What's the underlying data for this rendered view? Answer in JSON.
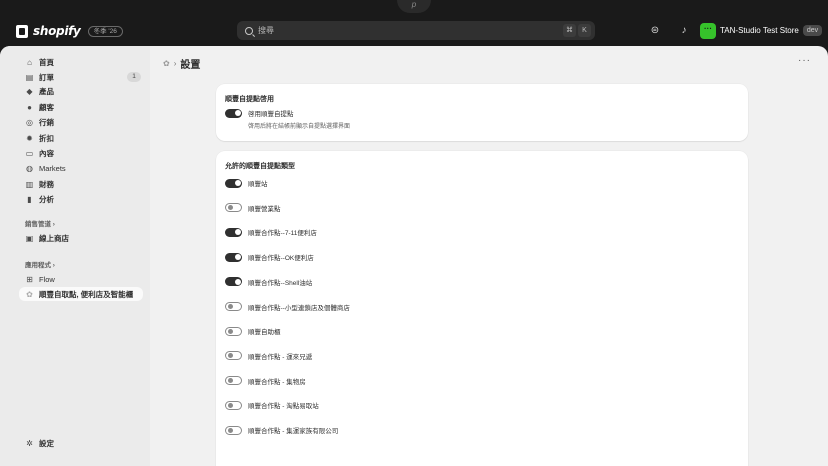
{
  "topbar": {
    "logo_text": "shopify",
    "version_badge": "冬季 '26",
    "search_placeholder": "搜尋",
    "shortcut_key1": "⌘",
    "shortcut_key2": "K",
    "notch_glyph": "p",
    "store_avatar_glyph": "···",
    "store_name": "TAN-Studio Test Store",
    "store_badge": "dev"
  },
  "sidebar": {
    "items": [
      {
        "label": "首頁",
        "icon": "home-icon",
        "glyph": "⌂"
      },
      {
        "label": "訂單",
        "icon": "orders-icon",
        "glyph": "▤",
        "count": "1"
      },
      {
        "label": "產品",
        "icon": "tag-icon",
        "glyph": "◆"
      },
      {
        "label": "顧客",
        "icon": "person-icon",
        "glyph": "●"
      },
      {
        "label": "行銷",
        "icon": "target-icon",
        "glyph": "◎"
      },
      {
        "label": "折扣",
        "icon": "discount-icon",
        "glyph": "✹"
      },
      {
        "label": "內容",
        "icon": "content-icon",
        "glyph": "▭"
      },
      {
        "label": "Markets",
        "icon": "globe-icon",
        "glyph": "◍"
      },
      {
        "label": "財務",
        "icon": "bank-icon",
        "glyph": "▥"
      },
      {
        "label": "分析",
        "icon": "chart-icon",
        "glyph": "▮"
      }
    ],
    "sales_channels_label": "銷售管道 ›",
    "online_store": {
      "label": "線上商店",
      "icon": "store-icon",
      "glyph": "▣"
    },
    "apps_label": "應用程式 ›",
    "flow": {
      "label": "Flow",
      "icon": "flow-icon",
      "glyph": "⊞"
    },
    "active_app": {
      "label": "順豐自取點, 便利店及智能櫃",
      "icon": "app-icon",
      "glyph": "✿"
    },
    "settings": {
      "label": "設定",
      "icon": "gear-icon",
      "glyph": "✲"
    }
  },
  "page": {
    "breadcrumb_icon_glyph": "✿",
    "breadcrumb_sep": "›",
    "title": "設置",
    "more_label": "···"
  },
  "card1": {
    "title": "順豐自提點啓用",
    "toggle_label": "啓用順豐自提點",
    "toggle_on": true,
    "help": "啓用后將在結帳前顯示自提點選擇界面"
  },
  "card2": {
    "title": "允許的順豐自提點類型",
    "options": [
      {
        "label": "順豐站",
        "on": true
      },
      {
        "label": "順豐營業點",
        "on": false
      },
      {
        "label": "順豐合作點--7-11便利店",
        "on": true
      },
      {
        "label": "順豐合作點--OK便利店",
        "on": true
      },
      {
        "label": "順豐合作點--Shell油站",
        "on": true
      },
      {
        "label": "順豐合作點--小型連鎖店及個體商店",
        "on": false
      },
      {
        "label": "順豐自助櫃",
        "on": false
      },
      {
        "label": "順豐合作點 - 運來兄遞",
        "on": false
      },
      {
        "label": "順豐合作點 - 集物房",
        "on": false
      },
      {
        "label": "順豐合作點 - 淘點易取站",
        "on": false
      },
      {
        "label": "順豐合作點 - 集運家族有限公司",
        "on": false
      }
    ]
  },
  "colors": {
    "topbar": "#1a1a1a",
    "toggle_on": "#303030",
    "store_avatar": "#36c22b"
  }
}
